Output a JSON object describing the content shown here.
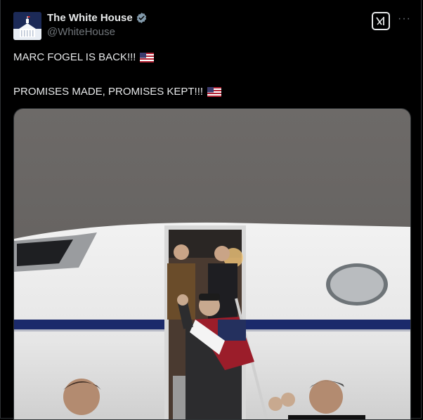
{
  "post": {
    "author": {
      "display_name": "The White House",
      "handle": "@WhiteHouse",
      "verified_icon": "verified-badge-icon"
    },
    "header_actions": {
      "grok_icon": "grok-icon",
      "more_label": "···"
    },
    "text_line_1": "MARC FOGEL IS BACK!!!",
    "text_line_2": "PROMISES MADE, PROMISES KEPT!!!",
    "emoji": "us-flag-icon",
    "media": {
      "type": "photo",
      "icon": "photo-icon"
    }
  },
  "colors": {
    "background": "#000000",
    "text": "#e7e9ea",
    "secondary_text": "#71767b",
    "verified": "#829aab",
    "jet_stripe": "#1b2a6b"
  }
}
